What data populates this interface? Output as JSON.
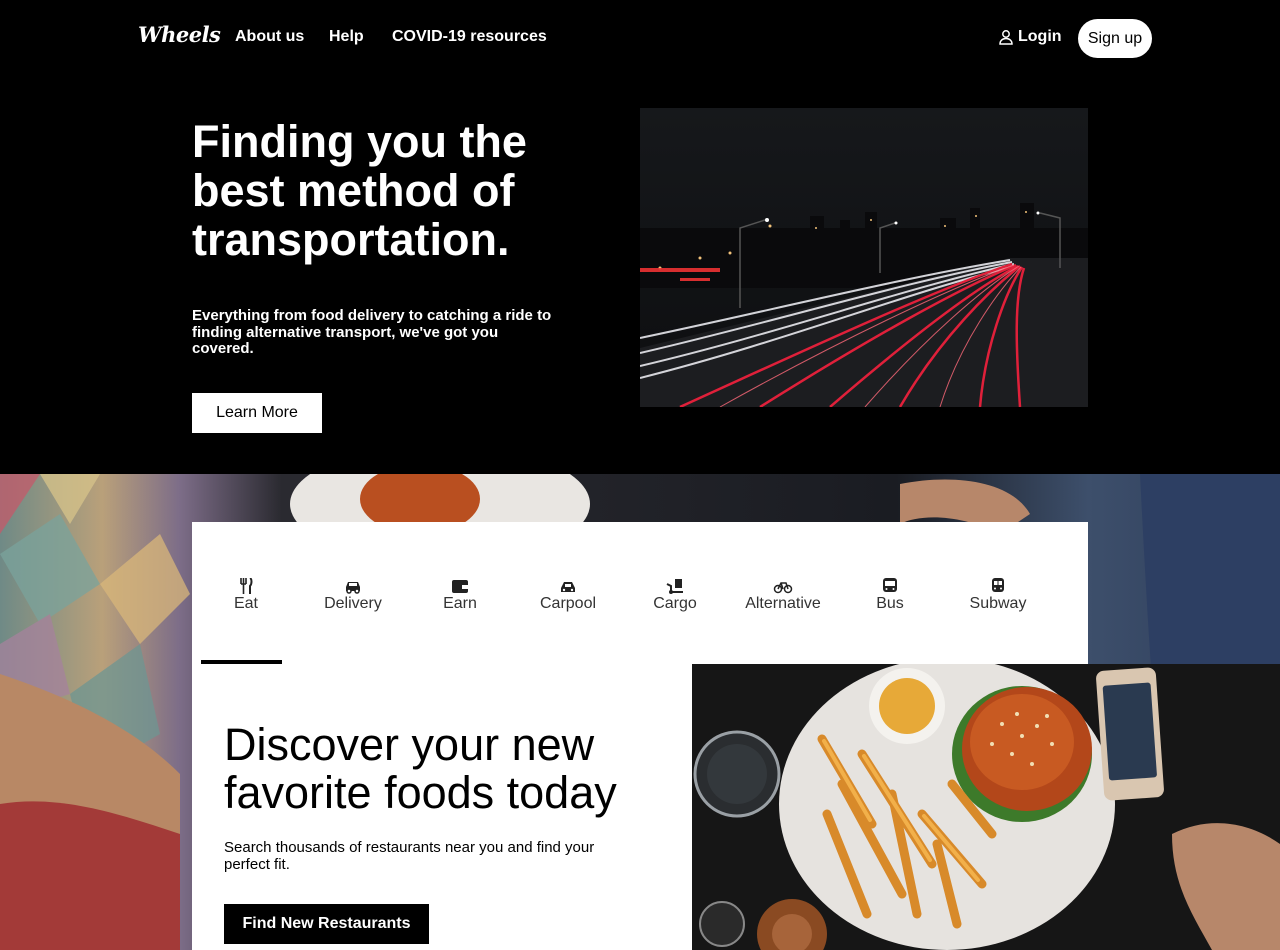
{
  "nav": {
    "logo": "Wheels",
    "links": [
      "About us",
      "Help",
      "COVID-19 resources"
    ],
    "login": "Login",
    "signup": "Sign up"
  },
  "hero": {
    "title": "Finding you the best method of transportation.",
    "subtitle": "Everything from food delivery to catching a ride to finding alternative transport, we've got you covered.",
    "button": "Learn More"
  },
  "tabs": [
    {
      "label": "Eat",
      "icon": "utensils-icon"
    },
    {
      "label": "Delivery",
      "icon": "car-icon"
    },
    {
      "label": "Earn",
      "icon": "wallet-icon"
    },
    {
      "label": "Carpool",
      "icon": "car-side-icon"
    },
    {
      "label": "Cargo",
      "icon": "dolly-icon"
    },
    {
      "label": "Alternative",
      "icon": "bicycle-icon"
    },
    {
      "label": "Bus",
      "icon": "bus-icon"
    },
    {
      "label": "Subway",
      "icon": "subway-icon"
    }
  ],
  "active_tab": "Eat",
  "content": {
    "title": "Discover your new favorite foods today",
    "subtitle": "Search thousands of restaurants near you and find your perfect fit.",
    "button": "Find New Restaurants"
  }
}
